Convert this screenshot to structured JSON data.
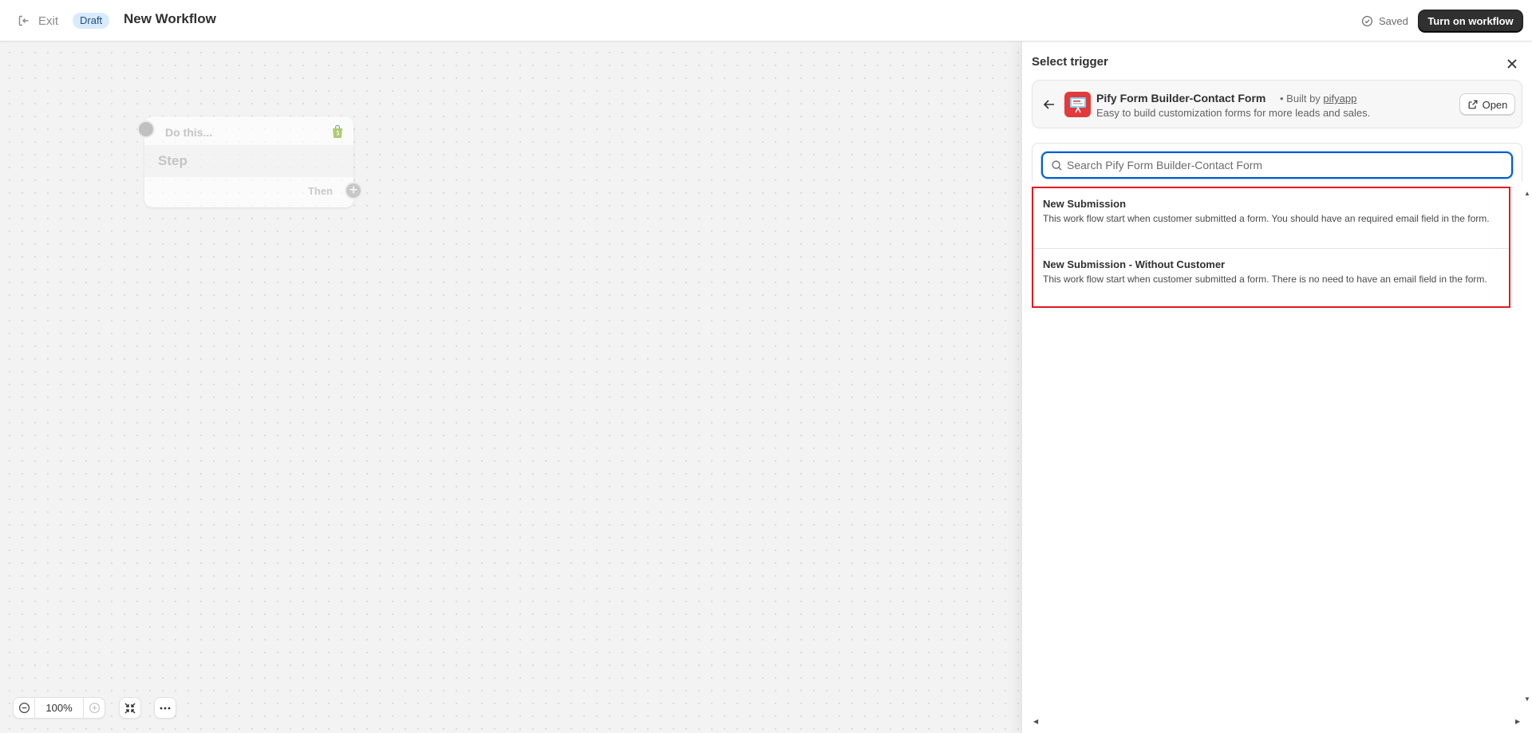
{
  "topbar": {
    "exit_label": "Exit",
    "status_badge": "Draft",
    "workflow_title": "New Workflow",
    "saved_label": "Saved",
    "turn_on_label": "Turn on workflow"
  },
  "canvas": {
    "step": {
      "header": "Do this...",
      "title": "Step",
      "then_label": "Then"
    },
    "zoom_level": "100%"
  },
  "panel": {
    "title": "Select trigger",
    "app": {
      "name": "Pify Form Builder-Contact Form",
      "built_by_prefix": "• Built by",
      "built_by_link": "pifyapp",
      "description": "Easy to build customization forms for more leads and sales.",
      "open_label": "Open"
    },
    "search": {
      "placeholder": "Search Pify Form Builder-Contact Form",
      "value": ""
    },
    "triggers": [
      {
        "name": "New Submission",
        "description": "This work flow start when customer submitted a form. You should have an required email field in the form."
      },
      {
        "name": "New Submission - Without Customer",
        "description": "This work flow start when customer submitted a form. There is no need to have an email field in the form."
      }
    ]
  },
  "colors": {
    "accent_blue": "#005bd3",
    "primary_button": "#303030",
    "highlight_border": "#e11b22",
    "draft_badge_bg": "#d9eafd",
    "app_logo_bg": "#e23b3b"
  },
  "icons": {
    "exit": "exit-icon",
    "saved": "check-circle-icon",
    "close": "close-icon",
    "back": "arrow-left-icon",
    "open": "external-link-icon",
    "search": "search-icon",
    "zoom_out": "minus-circle-icon",
    "zoom_in": "plus-circle-icon",
    "fit": "collapse-icon",
    "more": "ellipsis-icon",
    "shopify": "shopify-bag-icon",
    "add": "plus-icon"
  }
}
